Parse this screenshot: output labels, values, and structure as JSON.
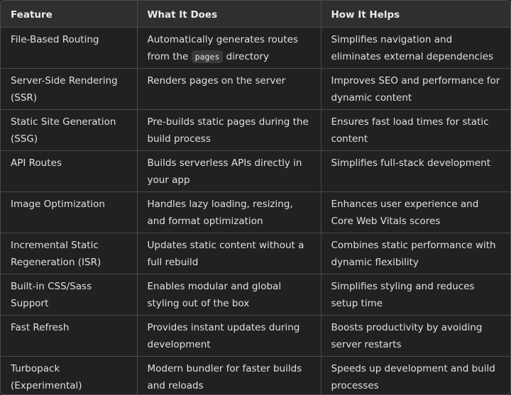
{
  "table": {
    "headers": [
      "Feature",
      "What It Does",
      "How It Helps"
    ],
    "rows": [
      {
        "feature": "File-Based Routing",
        "what_prefix": "Automatically generates routes from the ",
        "what_code": "pages",
        "what_suffix": " directory",
        "helps": "Simplifies navigation and eliminates external dependencies"
      },
      {
        "feature": "Server-Side Rendering (SSR)",
        "what": "Renders pages on the server",
        "helps": "Improves SEO and performance for dynamic content"
      },
      {
        "feature": "Static Site Generation (SSG)",
        "what": "Pre-builds static pages during the build process",
        "helps": "Ensures fast load times for static content"
      },
      {
        "feature": "API Routes",
        "what": "Builds serverless APIs directly in your app",
        "helps": "Simplifies full-stack development"
      },
      {
        "feature": "Image Optimization",
        "what": "Handles lazy loading, resizing, and format optimization",
        "helps": "Enhances user experience and Core Web Vitals scores"
      },
      {
        "feature": "Incremental Static Regeneration (ISR)",
        "what": "Updates static content without a full rebuild",
        "helps": "Combines static performance with dynamic flexibility"
      },
      {
        "feature": "Built-in CSS/Sass Support",
        "what": "Enables modular and global styling out of the box",
        "helps": "Simplifies styling and reduces setup time"
      },
      {
        "feature": "Fast Refresh",
        "what": "Provides instant updates during development",
        "helps": "Boosts productivity by avoiding server restarts"
      },
      {
        "feature": "Turbopack (Experimental)",
        "what": "Modern bundler for faster builds and reloads",
        "helps": "Speeds up development and build processes"
      }
    ]
  }
}
